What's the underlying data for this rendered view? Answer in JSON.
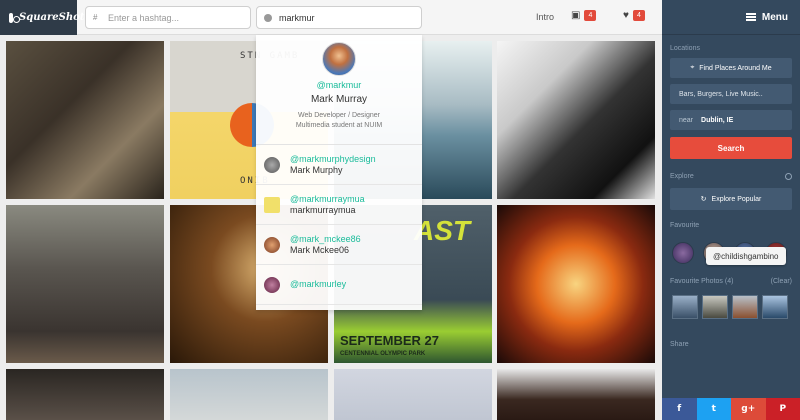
{
  "app": {
    "name": "SquareShot"
  },
  "topbar": {
    "hashtag_placeholder": "Enter a hashtag...",
    "user_search_value": "markmur",
    "intro_label": "Intro",
    "inbox_count": "4",
    "likes_count": "4",
    "icons": {
      "logo": "camera-icon",
      "hashtag": "hash-icon",
      "user": "user-icon",
      "inbox": "inbox-icon",
      "likes": "heart-icon"
    }
  },
  "dropdown": {
    "profile": {
      "handle": "@markmur",
      "name": "Mark Murray",
      "bio_line1": "Web Developer / Designer",
      "bio_line2": "Multimedia student at NUIM"
    },
    "results": [
      {
        "handle": "@markmurphydesign",
        "name": "Mark Murphy"
      },
      {
        "handle": "@markmurraymua",
        "name": "markmurraymua"
      },
      {
        "handle": "@mark_mckee86",
        "name": "Mark Mckee06"
      },
      {
        "handle": "@markmurley",
        "name": ""
      }
    ]
  },
  "grid": {
    "poster_text": {
      "p12_top": "STN GAMB",
      "p12_bottom": "ONIB",
      "p23_title": "AST",
      "p23_date": "SEPTEMBER 27",
      "p23_venue": "CENTENNIAL OLYMPIC PARK"
    }
  },
  "sidebar": {
    "menu_label": "Menu",
    "locations_title": "Locations",
    "find_places_label": "Find Places Around Me",
    "place_query": "Bars, Burgers, Live Music..",
    "near_label": "near",
    "near_value": "Dublin, IE",
    "search_label": "Search",
    "explore_title": "Explore",
    "explore_popular_label": "Explore Popular",
    "favourite_users_title": "Favourite",
    "favourite_photos_title": "Favourite Photos (4)",
    "clear_label": "(Clear)",
    "share_title": "Share",
    "tooltip": "@childishgambino",
    "share_buttons": [
      {
        "label": "f",
        "color": "#3b5998"
      },
      {
        "label": "t",
        "color": "#1da1f2"
      },
      {
        "label": "g+",
        "color": "#dd4b39"
      },
      {
        "label": "P",
        "color": "#cb2027"
      }
    ]
  },
  "colors": {
    "accent": "#1bbc9b",
    "sidebar": "#34495e",
    "search_button": "#e74c3c",
    "badge": "#e24a3b"
  }
}
